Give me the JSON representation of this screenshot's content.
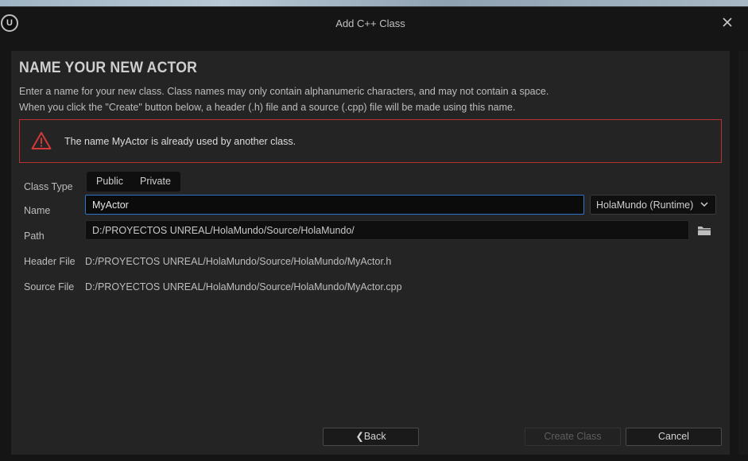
{
  "window": {
    "title": "Add C++ Class"
  },
  "heading": "NAME YOUR NEW ACTOR",
  "description": {
    "line1": "Enter a name for your new class. Class names may only contain alphanumeric characters, and may not contain a space.",
    "line2": "When you click the \"Create\" button below, a header (.h) file and a source (.cpp) file will be made using this name."
  },
  "error": {
    "message": "The name MyActor is already used by another class.",
    "color": "#b83232"
  },
  "form": {
    "class_type_label": "Class Type",
    "class_type_options": [
      "Public",
      "Private"
    ],
    "name_label": "Name",
    "name_value": "MyActor",
    "module_value": "HolaMundo (Runtime)",
    "path_label": "Path",
    "path_value": "D:/PROYECTOS UNREAL/HolaMundo/Source/HolaMundo/",
    "header_label": "Header File",
    "header_value": "D:/PROYECTOS UNREAL/HolaMundo/Source/HolaMundo/MyActor.h",
    "source_label": "Source File",
    "source_value": "D:/PROYECTOS UNREAL/HolaMundo/Source/HolaMundo/MyActor.cpp"
  },
  "buttons": {
    "back": "Back",
    "create": "Create Class",
    "cancel": "Cancel"
  },
  "icons": {
    "logo": "unreal-logo-icon",
    "close": "close-icon",
    "warning": "warning-icon",
    "folder": "folder-icon",
    "chevron": "chevron-down-icon"
  },
  "colors": {
    "accent": "#2f73c4",
    "panel": "#242424",
    "error": "#b83232"
  }
}
